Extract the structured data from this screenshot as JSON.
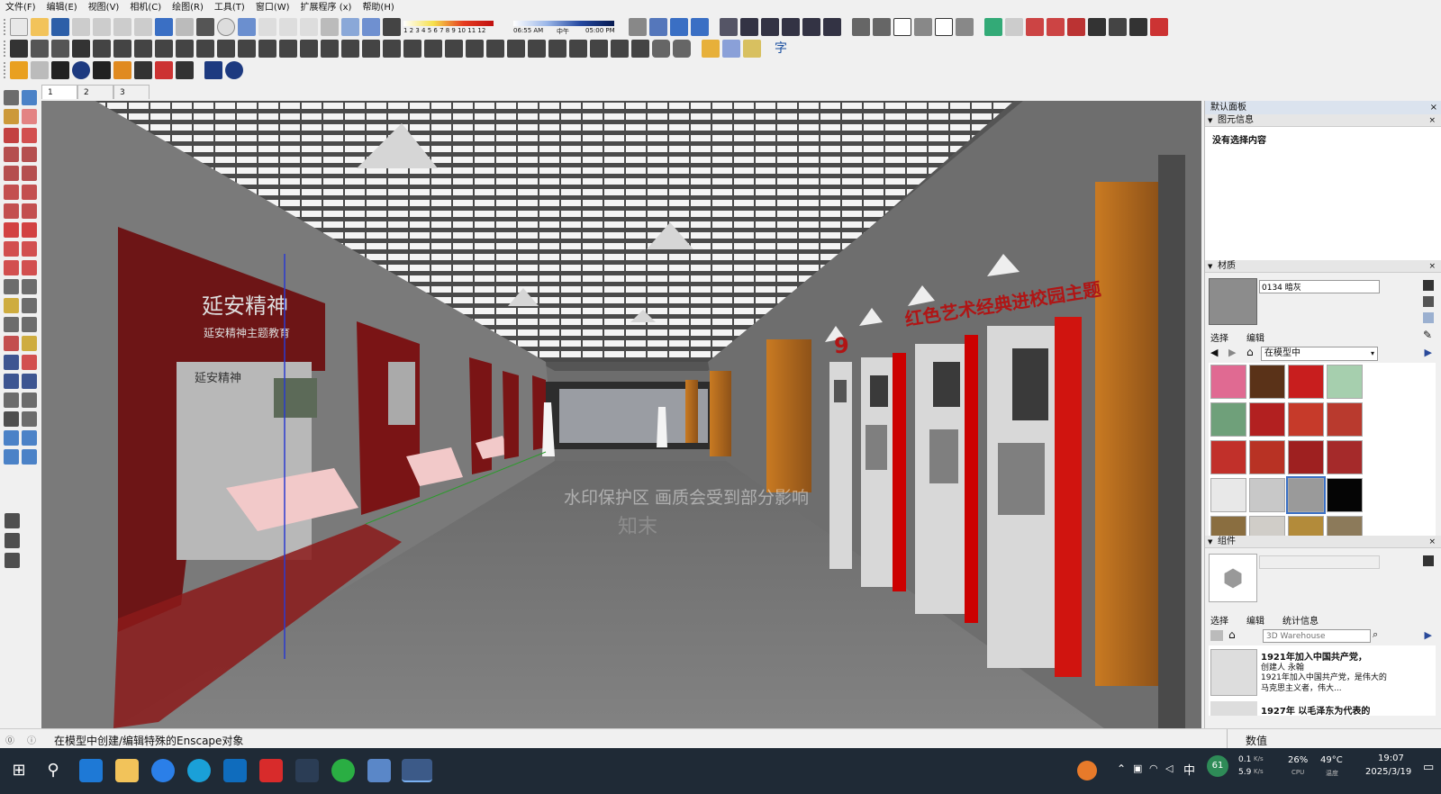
{
  "menubar": {
    "items": [
      "文件(F)",
      "编辑(E)",
      "视图(V)",
      "相机(C)",
      "绘图(R)",
      "工具(T)",
      "窗口(W)",
      "扩展程序 (x)",
      "帮助(H)"
    ]
  },
  "shadow_bar": {
    "months": "1 2 3 4 5 6 7 8 9 10 11 12",
    "time_start": "06:55 AM",
    "noon": "中午",
    "time_end": "05:00 PM"
  },
  "text_tool_label": "字",
  "scene_tabs": [
    "1",
    "2",
    "3"
  ],
  "viewport": {
    "sign_left_title": "延安精神",
    "sign_left_sub": "延安精神主题教育",
    "sign_left_small": "延安精神",
    "banner_right": "红色艺术经典进校园主题",
    "watermark": "水印保护区   画质会受到部分影响",
    "watermark_logo": "知末"
  },
  "panel": {
    "title": "默认面板",
    "entity_info": {
      "header": "图元信息",
      "empty_text": "没有选择内容"
    },
    "materials": {
      "header": "材质",
      "current_name": "0134 暗灰",
      "tab_select": "选择",
      "tab_edit": "编辑",
      "location": "在模型中",
      "swatch_colors": [
        "#e06a92",
        "#5a3218",
        "#c81e1e",
        "#a6cfae",
        "#6fa07a",
        "#b22020",
        "#c63a2a",
        "#b93a2e",
        "#c1302a",
        "#b83224",
        "#9e2020",
        "#a52a2a",
        "#e8e8e8",
        "#c8c8c8",
        "#9a9a9a",
        "#050505",
        "#8a6e40",
        "#d0cdc8",
        "#b38b3a",
        "#8c7a5a"
      ]
    },
    "components": {
      "header": "组件",
      "tab_select": "选择",
      "tab_edit": "编辑",
      "tab_stats": "统计信息",
      "search_placeholder": "3D Warehouse",
      "results": [
        {
          "title": "1921年加入中国共产党，",
          "author": "创建人 永翰",
          "desc": "1921年加入中国共产党，是伟大的马克思主义者，伟大..."
        },
        {
          "title": "1927年 以毛泽东为代表的"
        }
      ]
    }
  },
  "statusbar": {
    "message": "在模型中创建/编辑特殊的Enscape对象",
    "value_label": "数值"
  },
  "taskbar": {
    "net_up": "0.1",
    "net_up_unit": "K/s",
    "net_down": "5.9",
    "net_down_unit": "K/s",
    "cpu": "26%",
    "cpu_label": "CPU",
    "temp": "49°C",
    "temp_label": "温度",
    "ime": "中",
    "badge": "61",
    "time": "19:07",
    "date": "2025/3/19"
  }
}
